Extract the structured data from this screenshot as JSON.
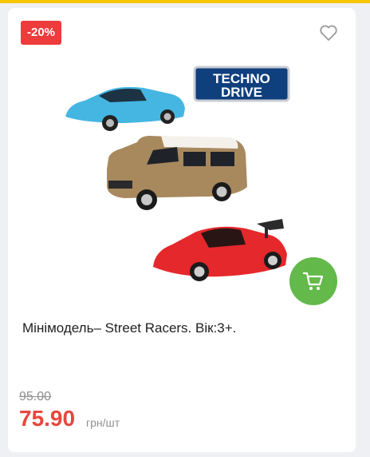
{
  "product": {
    "discount_badge": "-20%",
    "brand_logo": "TECHNO DRIVE",
    "title": "Мінімодель– Street Racers. Вік:3+.",
    "old_price": "95.00",
    "price": "75.90",
    "unit": "грн/шт"
  },
  "icons": {
    "wishlist": "heart-outline-icon",
    "cart": "cart-icon"
  },
  "colors": {
    "accent_yellow": "#f7c600",
    "badge_red": "#ee3b3b",
    "price_red": "#e8463c",
    "cart_green": "#63b94a"
  }
}
